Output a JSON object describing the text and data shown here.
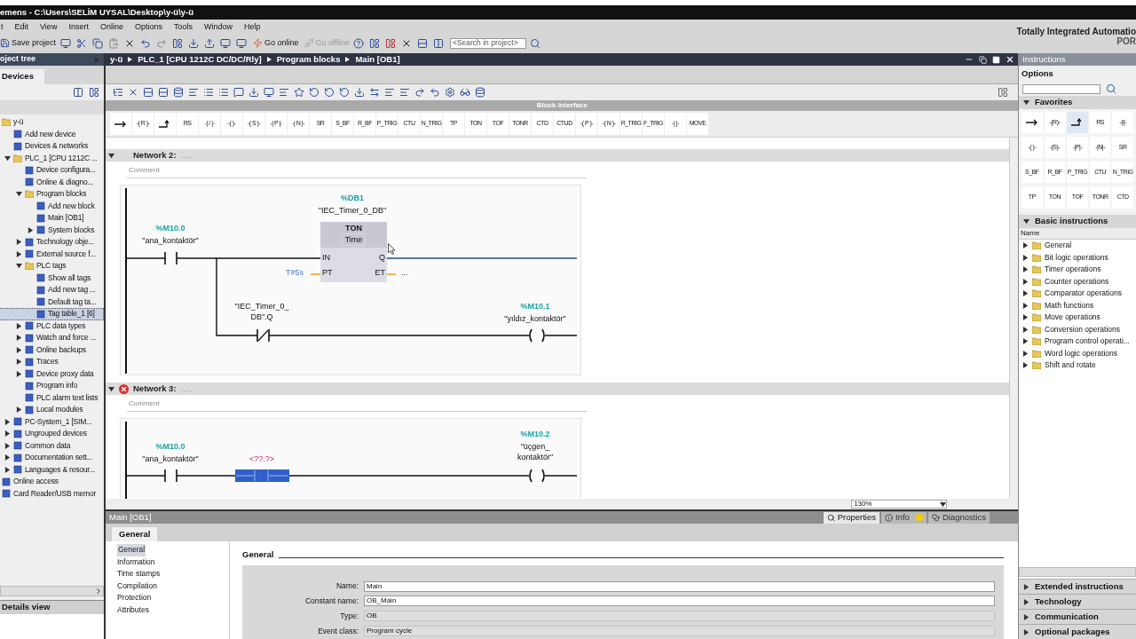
{
  "title_bar": {
    "title": "emens  -  C:\\Users\\SELİM UYSAL\\Desktop\\y-ü\\y-ü",
    "brand": "Totally Integrated Automatio",
    "brand_sub": "POR"
  },
  "menu": [
    "t",
    "Edit",
    "View",
    "Insert",
    "Online",
    "Options",
    "Tools",
    "Window",
    "Help"
  ],
  "toolbar": {
    "save": "Save project",
    "go_online": "Go online",
    "go_offline": "Go offline",
    "go_offline_disabled": true,
    "search": {
      "placeholder": "<Search in project>"
    }
  },
  "project_tree": {
    "title": "oject tree",
    "tab": "Devices",
    "details_view": "Details view",
    "items": [
      {
        "label": "y-ü",
        "selected": false,
        "children": [
          {
            "label": "Add new device",
            "selected": false
          },
          {
            "label": "Devices & networks",
            "selected": false
          },
          {
            "label": "PLC_1 [CPU 1212C ...",
            "selected": false,
            "expanded": true,
            "children": [
              {
                "label": "Device configura...",
                "selected": false
              },
              {
                "label": "Online & diagno...",
                "selected": false
              },
              {
                "label": "Program blocks",
                "selected": false,
                "expanded": true,
                "children": [
                  {
                    "label": "Add new block",
                    "selected": false
                  },
                  {
                    "label": "Main [OB1]",
                    "selected": false
                  },
                  {
                    "label": "System blocks",
                    "selected": false,
                    "expanded": false
                  }
                ]
              },
              {
                "label": "Technology obje...",
                "selected": false,
                "expanded": false
              },
              {
                "label": "External source f...",
                "selected": false,
                "expanded": false
              },
              {
                "label": "PLC tags",
                "selected": false,
                "expanded": true,
                "children": [
                  {
                    "label": "Show all tags",
                    "selected": false
                  },
                  {
                    "label": "Add new tag ...",
                    "selected": false
                  },
                  {
                    "label": "Default tag ta...",
                    "selected": false
                  },
                  {
                    "label": "Tag table_1 [6]",
                    "selected": true
                  }
                ]
              },
              {
                "label": "PLC data types",
                "selected": false,
                "expanded": false
              },
              {
                "label": "Watch and force ...",
                "selected": false,
                "expanded": false
              },
              {
                "label": "Online backups",
                "selected": false,
                "expanded": false
              },
              {
                "label": "Traces",
                "selected": false,
                "expanded": false
              },
              {
                "label": "Device proxy data",
                "selected": false,
                "expanded": false
              },
              {
                "label": "Program info",
                "selected": false
              },
              {
                "label": "PLC alarm text lists",
                "selected": false
              },
              {
                "label": "Local modules",
                "selected": false,
                "expanded": false
              }
            ]
          },
          {
            "label": "PC-System_1 [SIM...",
            "selected": false,
            "expanded": false
          },
          {
            "label": "Ungrouped devices",
            "selected": false,
            "expanded": false
          },
          {
            "label": "Common data",
            "selected": false,
            "expanded": false
          },
          {
            "label": "Documentation sett...",
            "selected": false,
            "expanded": false
          },
          {
            "label": "Languages & resour...",
            "selected": false,
            "expanded": false
          }
        ]
      },
      {
        "label": "Online access",
        "selected": false
      },
      {
        "label": "Card Reader/USB memor",
        "selected": false
      }
    ]
  },
  "editor": {
    "breadcrumb": [
      "y-ü",
      "PLC_1 [CPU 1212C DC/DC/Rly]",
      "Program blocks",
      "Main [OB1]"
    ],
    "block_interface": "Block interface",
    "instructions": [
      {
        "kind": "icon"
      },
      {
        "kind": "text",
        "label": "-( R )-"
      },
      {
        "kind": "icon"
      },
      {
        "kind": "text",
        "label": "RS"
      },
      {
        "kind": "text",
        "label": "-| / |-"
      },
      {
        "kind": "text",
        "label": "-(  )-"
      },
      {
        "kind": "text",
        "label": "-( S )-"
      },
      {
        "kind": "text",
        "label": "-| P |-"
      },
      {
        "kind": "text",
        "label": "-| N |-"
      },
      {
        "kind": "text",
        "label": "SR"
      },
      {
        "kind": "text",
        "label": "S_BF"
      },
      {
        "kind": "text",
        "label": "R_BF"
      },
      {
        "kind": "text",
        "label": "P_TRIG"
      },
      {
        "kind": "text",
        "label": "CTU"
      },
      {
        "kind": "text",
        "label": "N_TRIG"
      },
      {
        "kind": "text",
        "label": "TP"
      },
      {
        "kind": "text",
        "label": "TON"
      },
      {
        "kind": "text",
        "label": "TOF"
      },
      {
        "kind": "text",
        "label": "TONR"
      },
      {
        "kind": "text",
        "label": "CTD"
      },
      {
        "kind": "text",
        "label": "CTUD"
      },
      {
        "kind": "text",
        "label": "-( P )-"
      },
      {
        "kind": "text",
        "label": "-( N )-"
      },
      {
        "kind": "text",
        "label": "R_TRIG"
      },
      {
        "kind": "text",
        "label": "F_TRIG"
      },
      {
        "kind": "text",
        "label": "-|  |-"
      },
      {
        "kind": "text",
        "label": "MOVE"
      }
    ],
    "networks": [
      {
        "kind": "timer_branch",
        "title": "Network 2:",
        "dots": ".....",
        "error": false,
        "expanded": true,
        "comment": "Comment",
        "contact": {
          "address": "%M10.0",
          "symbol": "\"ana_kontaktör\""
        },
        "timer": {
          "address": "%DB1",
          "name": "\"IEC_Timer_0_DB\"",
          "type": "TON",
          "datatype": "Time",
          "in": "IN",
          "q": "Q",
          "pt": "PT",
          "et": "ET",
          "pt_value": "T#5s",
          "et_value": "..."
        },
        "nc_contact": {
          "symbol": [
            "\"IEC_Timer_0_",
            "DB\".Q"
          ]
        },
        "coil": {
          "address": "%M10.1",
          "symbol": [
            "\"yıldız_kontaktör\""
          ]
        }
      },
      {
        "kind": "contact_coil",
        "title": "Network 3:",
        "dots": ".....",
        "error": true,
        "expanded": true,
        "comment": "Comment",
        "contact": {
          "address": "%M10.0",
          "symbol": "\"ana_kontaktör\""
        },
        "empty_box": {
          "operand": "<??.?>"
        },
        "coil": {
          "address": "%M10.2",
          "symbol": [
            "\"üçgen_",
            "kontaktör\""
          ]
        }
      }
    ],
    "zoom": "130%"
  },
  "properties": {
    "title": "Main [OB1]",
    "tabs": [
      {
        "label": "Properties",
        "selected": true
      },
      {
        "label": "Info",
        "selected": false
      },
      {
        "label": "Diagnostics",
        "selected": false
      }
    ],
    "section_tab": "General",
    "nav": [
      {
        "label": "General",
        "selected": true
      },
      {
        "label": "Information",
        "selected": false
      },
      {
        "label": "Time stamps",
        "selected": false
      },
      {
        "label": "Compilation",
        "selected": false
      },
      {
        "label": "Protection",
        "selected": false
      },
      {
        "label": "Attributes",
        "selected": false
      }
    ],
    "heading": "General",
    "fields": [
      {
        "label": "Name:",
        "value": "Main",
        "editable": true
      },
      {
        "label": "Constant name:",
        "value": "OB_Main",
        "editable": true
      },
      {
        "label": "Type:",
        "value": "OB",
        "editable": false
      },
      {
        "label": "Event class:",
        "value": "Program cycle",
        "editable": false
      }
    ]
  },
  "instructions_panel": {
    "title": "Instructions",
    "options": "Options",
    "favorites": {
      "title": "Favorites",
      "expanded": true,
      "items": [
        {
          "kind": "icon",
          "selected": false
        },
        {
          "label": "-(R)-",
          "kind": "text",
          "selected": false
        },
        {
          "kind": "icon",
          "selected": true
        },
        {
          "label": "RS",
          "kind": "text",
          "selected": false
        },
        {
          "label": "-|/|-",
          "kind": "text",
          "selected": false
        },
        {
          "label": "-( )-",
          "kind": "text",
          "selected": false
        },
        {
          "label": "-(S)-",
          "kind": "text",
          "selected": false
        },
        {
          "label": "-|P|-",
          "kind": "text",
          "selected": false
        },
        {
          "label": "-|N|-",
          "kind": "text",
          "selected": false
        },
        {
          "label": "SR",
          "kind": "text",
          "selected": false
        },
        {
          "label": "S_BF",
          "kind": "text",
          "selected": false
        },
        {
          "label": "R_BF",
          "kind": "text",
          "selected": false
        },
        {
          "label": "P_TRIG",
          "kind": "text",
          "selected": false
        },
        {
          "label": "CTU",
          "kind": "text",
          "selected": false
        },
        {
          "label": "N_TRIG",
          "kind": "text",
          "selected": false
        },
        {
          "label": "TP",
          "kind": "text",
          "selected": false
        },
        {
          "label": "TON",
          "kind": "text",
          "selected": false
        },
        {
          "label": "TOF",
          "kind": "text",
          "selected": false
        },
        {
          "label": "TONR",
          "kind": "text",
          "selected": false
        },
        {
          "label": "CTD",
          "kind": "text",
          "selected": false
        }
      ]
    },
    "basic": {
      "title": "Basic instructions",
      "expanded": true,
      "column": "Name",
      "items": [
        {
          "label": "General",
          "expanded": false
        },
        {
          "label": "Bit logic operations",
          "expanded": false
        },
        {
          "label": "Timer operations",
          "expanded": false
        },
        {
          "label": "Counter operations",
          "expanded": false
        },
        {
          "label": "Comparator operations",
          "expanded": false
        },
        {
          "label": "Math functions",
          "expanded": false
        },
        {
          "label": "Move operations",
          "expanded": false
        },
        {
          "label": "Conversion operations",
          "expanded": false
        },
        {
          "label": "Program control operati...",
          "expanded": false
        },
        {
          "label": "Word logic operations",
          "expanded": false
        },
        {
          "label": "Shift and rotate",
          "expanded": false
        }
      ]
    },
    "sections": [
      {
        "title": "Extended instructions",
        "expanded": false
      },
      {
        "title": "Technology",
        "expanded": false
      },
      {
        "title": "Communication",
        "expanded": false
      },
      {
        "title": "Optional packages",
        "expanded": false
      }
    ]
  }
}
